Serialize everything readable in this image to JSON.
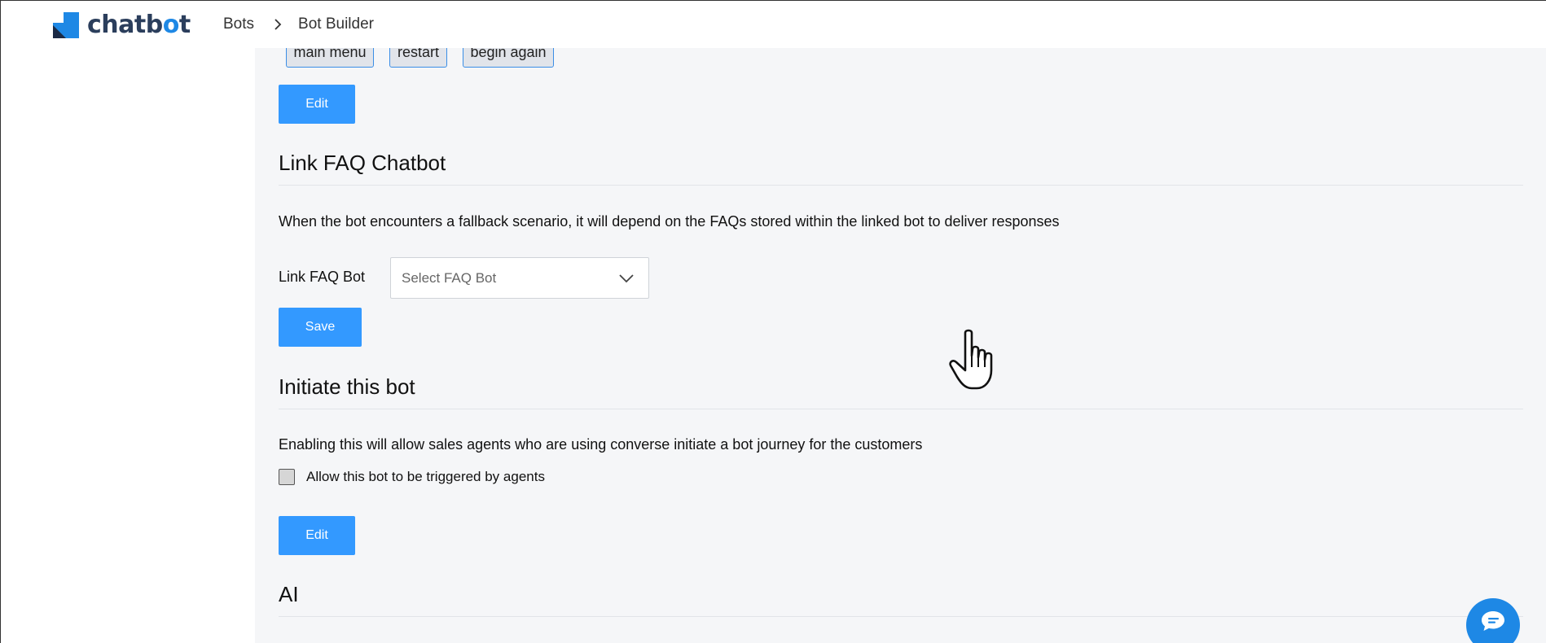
{
  "brand": {
    "name_prefix": "chatb",
    "name_o": "o",
    "name_suffix": "t",
    "accent": "#1e88e5",
    "text_color": "#2b3e5c"
  },
  "breadcrumb": {
    "items": [
      "Bots",
      "Bot Builder"
    ]
  },
  "quick_replies": {
    "chips": [
      "main menu",
      "restart",
      "begin again"
    ],
    "edit_label": "Edit"
  },
  "faq": {
    "title": "Link FAQ Chatbot",
    "description": "When the bot encounters a fallback scenario, it will depend on the FAQs stored within the linked bot to deliver responses",
    "field_label": "Link FAQ Bot",
    "select_placeholder": "Select FAQ Bot",
    "save_label": "Save"
  },
  "initiate": {
    "title": "Initiate this bot",
    "description": "Enabling this will allow sales agents who are using converse initiate a bot journey for the customers",
    "checkbox_label": "Allow this bot to be triggered by agents",
    "checked": false,
    "edit_label": "Edit"
  },
  "ai": {
    "title": "AI"
  },
  "colors": {
    "primary_button": "#3399ff",
    "content_bg": "#f5f6f8"
  }
}
